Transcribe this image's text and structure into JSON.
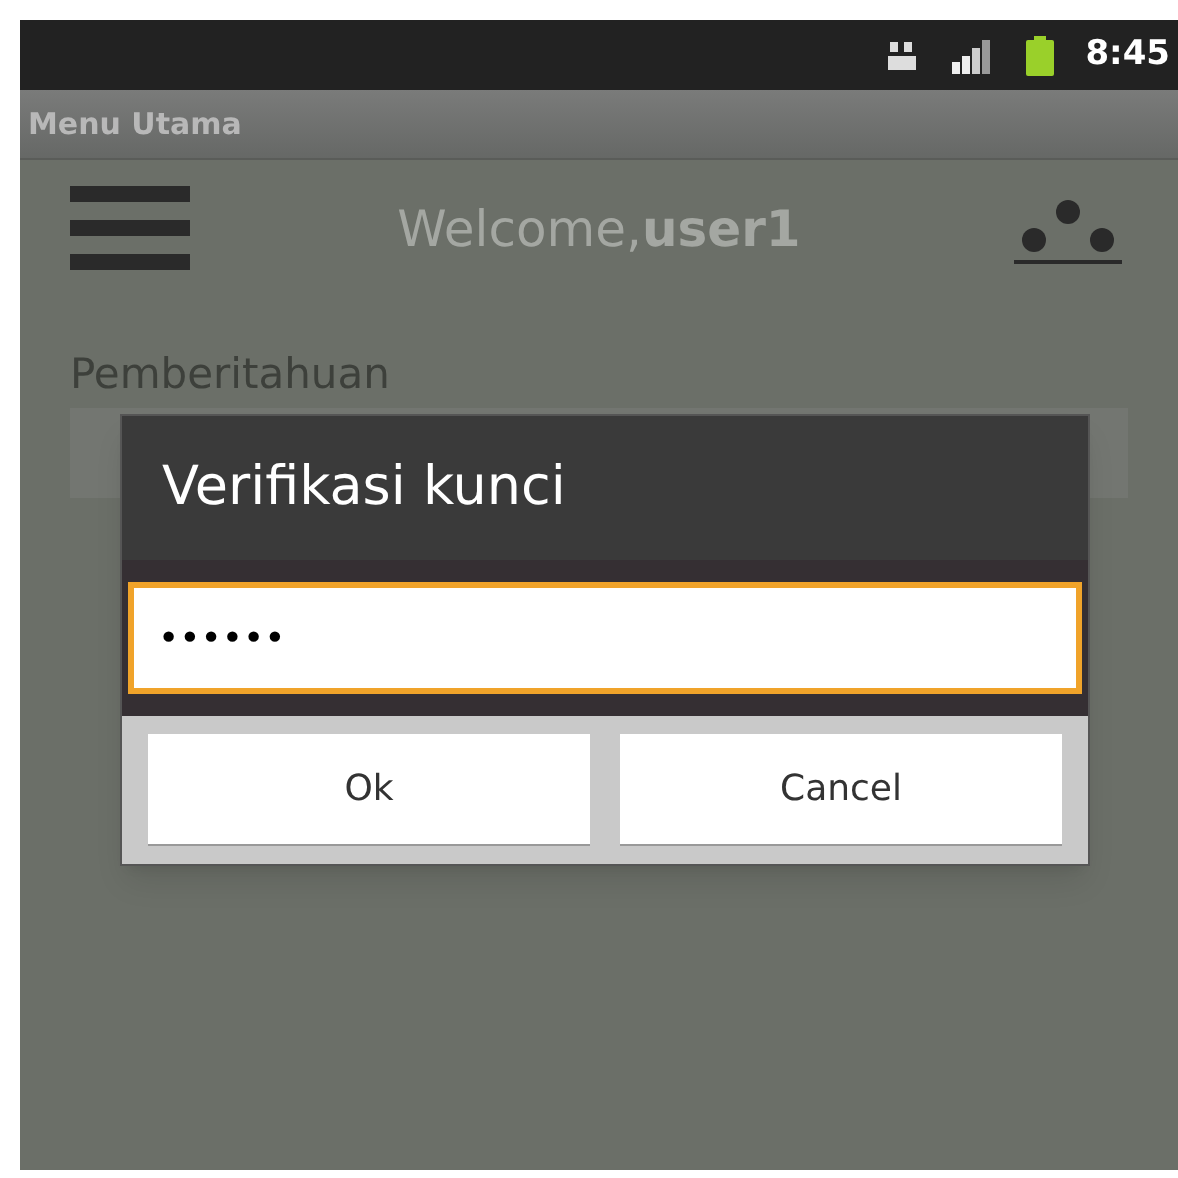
{
  "status_bar": {
    "time": "8:45"
  },
  "title_bar": {
    "title": "Menu Utama"
  },
  "header": {
    "welcome": "Welcome,**user1**"
  },
  "section": {
    "title": "Pemberitahuan"
  },
  "dialog": {
    "title": "Verifikasi kunci",
    "password": {
      "value": "••••••",
      "focused": true
    },
    "buttons": [
      {
        "label": "Ok"
      },
      {
        "label": "Cancel"
      }
    ]
  }
}
